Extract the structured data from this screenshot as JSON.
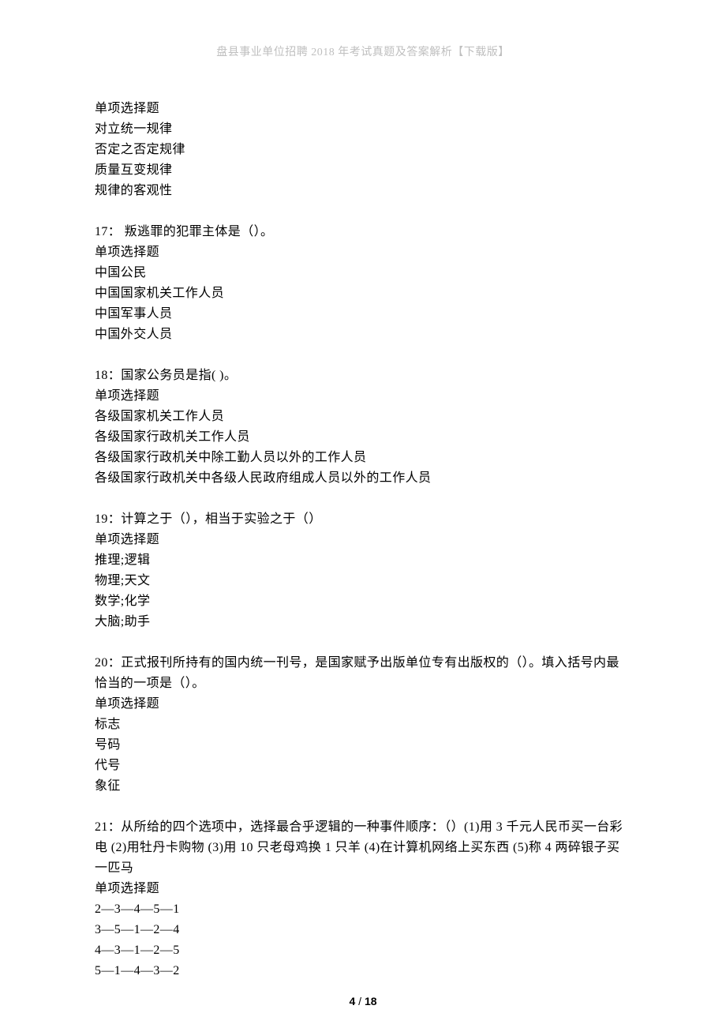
{
  "header": "盘县事业单位招聘 2018 年考试真题及答案解析【下载版】",
  "q16_tail": {
    "type": "单项选择题",
    "options": [
      "对立统一规律",
      "否定之否定规律",
      "质量互变规律",
      "规律的客观性"
    ]
  },
  "q17": {
    "stem": "17：  叛逃罪的犯罪主体是（）。",
    "type": "单项选择题",
    "options": [
      "中国公民",
      "中国国家机关工作人员",
      "中国军事人员",
      "中国外交人员"
    ]
  },
  "q18": {
    "stem": "18：国家公务员是指(  )。",
    "type": "单项选择题",
    "options": [
      "各级国家机关工作人员",
      "各级国家行政机关工作人员",
      "各级国家行政机关中除工勤人员以外的工作人员",
      "各级国家行政机关中各级人民政府组成人员以外的工作人员"
    ]
  },
  "q19": {
    "stem": "19：计算之于（），相当于实验之于（）",
    "type": "单项选择题",
    "options": [
      "推理;逻辑",
      "物理;天文",
      "数学;化学",
      "大脑;助手"
    ]
  },
  "q20": {
    "stem": "20：正式报刊所持有的国内统一刊号，是国家赋予出版单位专有出版权的（）。填入括号内最恰当的一项是（）。",
    "type": "单项选择题",
    "options": [
      "标志",
      "号码",
      "代号",
      "象征"
    ]
  },
  "q21": {
    "stem": "21：从所给的四个选项中，选择最合乎逻辑的一种事件顺序：（）(1)用 3 千元人民币买一台彩电 (2)用牡丹卡购物 (3)用 10 只老母鸡换 1 只羊 (4)在计算机网络上买东西 (5)称 4 两碎银子买一匹马",
    "type": "单项选择题",
    "options": [
      "2—3—4—5—1",
      "3—5—1—2—4",
      "4—3—1—2—5",
      "5—1—4—3—2"
    ]
  },
  "footer": {
    "current": "4",
    "sep": " / ",
    "total": "18"
  }
}
